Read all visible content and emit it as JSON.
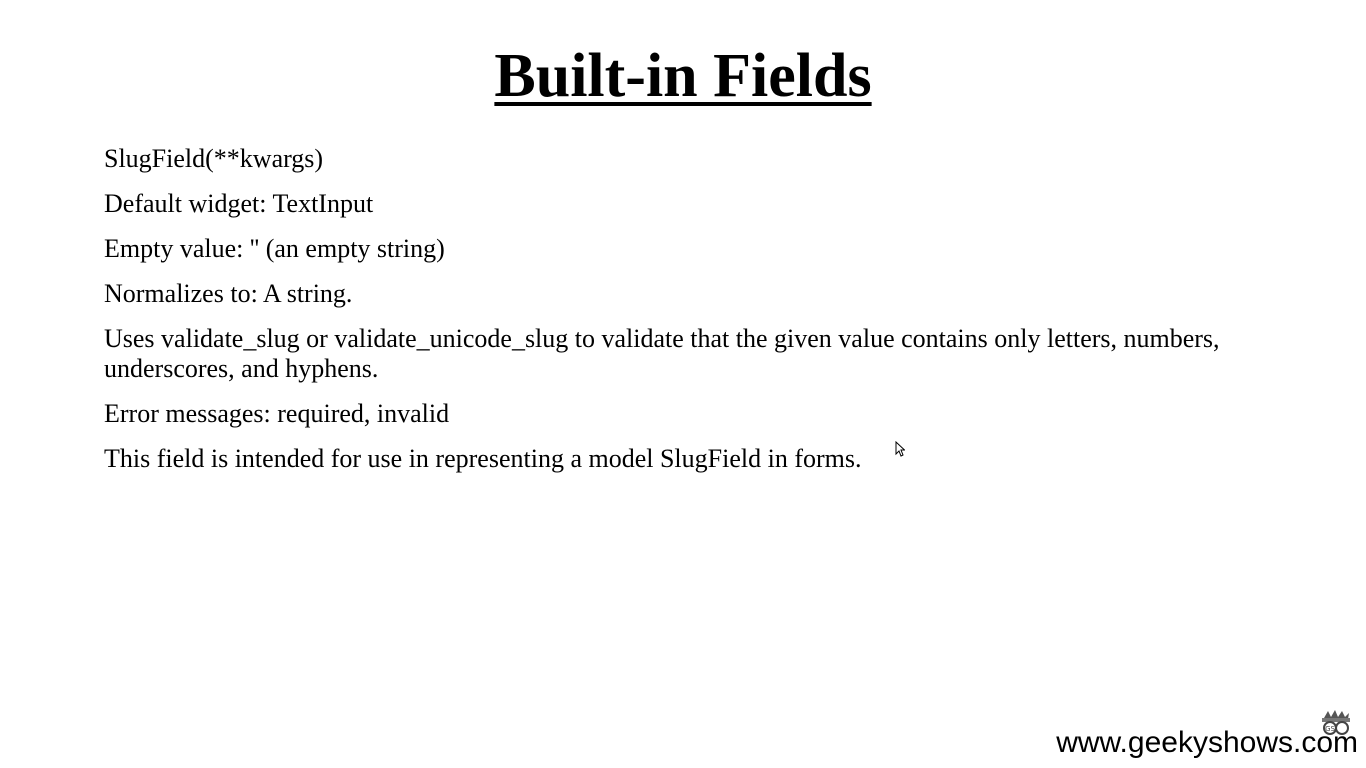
{
  "slide": {
    "title": "Built-in Fields",
    "paragraphs": [
      "SlugField(**kwargs)",
      "Default widget: TextInput",
      "Empty value: '' (an empty string)",
      "Normalizes to: A string.",
      "Uses validate_slug or validate_unicode_slug to validate that the given value contains only letters, numbers, underscores, and hyphens.",
      "Error messages: required, invalid",
      "This field is intended for use in representing a model SlugField in forms."
    ]
  },
  "watermark": {
    "url": "www.geekyshows.com",
    "logo": "GS"
  },
  "icons": {
    "cursor": "mouse-pointer-icon",
    "logo": "geekyshows-logo"
  }
}
